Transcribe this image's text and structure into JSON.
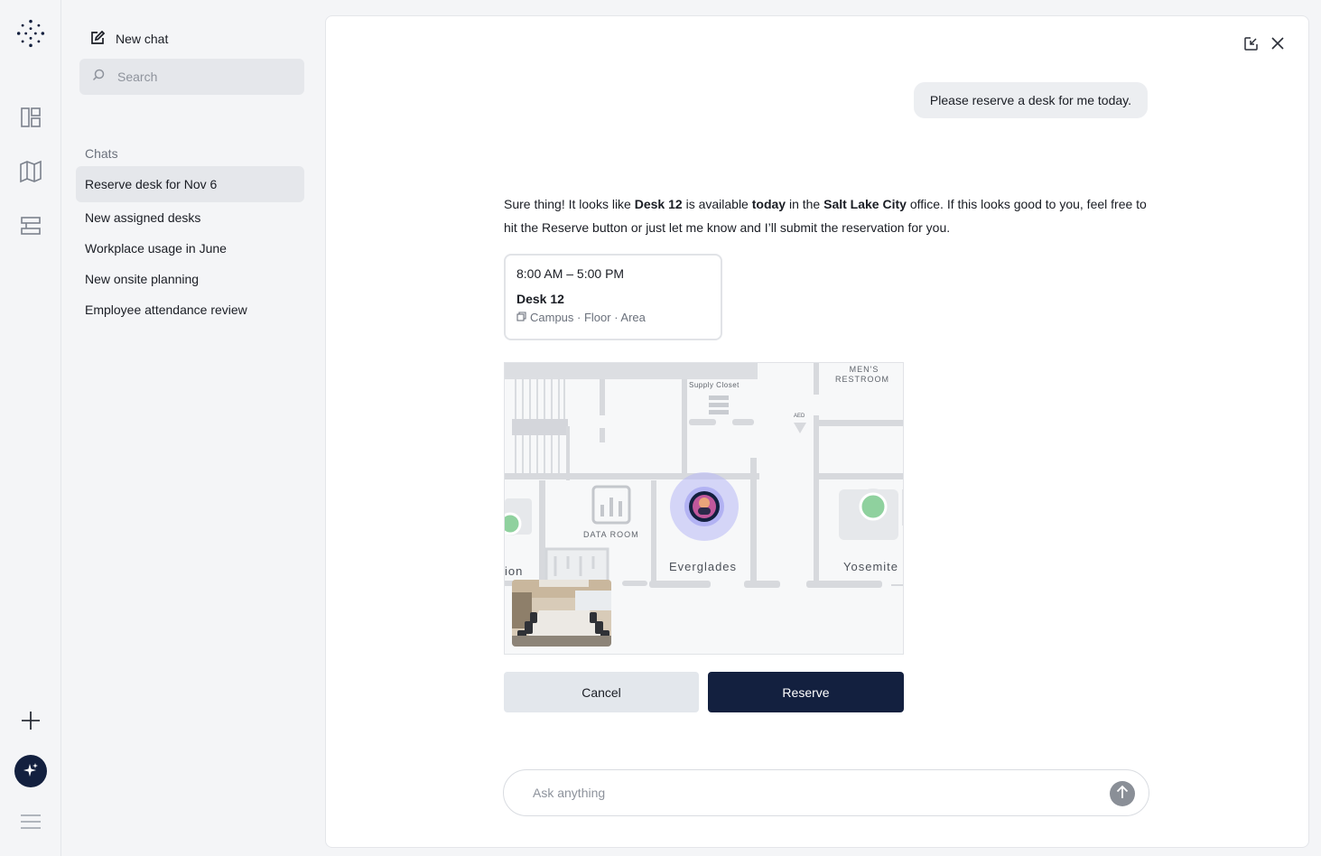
{
  "rail": {
    "icons": [
      "logo-icon",
      "dashboard-icon",
      "map-icon",
      "desk-icon",
      "plus-icon",
      "ai-sparkle-icon",
      "menu-icon"
    ]
  },
  "sidebar": {
    "new_chat_label": "New chat",
    "search_placeholder": "Search",
    "chats_heading": "Chats",
    "chats": [
      {
        "label": "Reserve desk for Nov 6",
        "active": true
      },
      {
        "label": "New assigned desks",
        "active": false
      },
      {
        "label": "Workplace usage in June",
        "active": false
      },
      {
        "label": "New onsite planning",
        "active": false
      },
      {
        "label": "Employee attendance review",
        "active": false
      }
    ]
  },
  "conversation": {
    "user_message": "Please reserve a desk for me today.",
    "assistant": {
      "p1": "Sure thing! It looks like ",
      "desk": "Desk 12",
      "p2": " is available ",
      "when": "today",
      "p3": " in the ",
      "office": "Salt Lake City",
      "p4": " office. If this looks good to you, feel free to hit the Reserve button or just let me know and I’ll submit the reservation for you."
    }
  },
  "reservation": {
    "time": "8:00 AM – 5:00 PM",
    "desk": "Desk 12",
    "location": "Campus · Floor · Area"
  },
  "map": {
    "labels": {
      "mens_restroom_1": "MEN'S",
      "mens_restroom_2": "RESTROOM",
      "supply_closet": "Supply Closet",
      "aed": "AED",
      "data_room": "DATA ROOM",
      "everglades": "Everglades",
      "yosemite": "Yosemite",
      "partial_room": "ion"
    }
  },
  "actions": {
    "cancel": "Cancel",
    "reserve": "Reserve"
  },
  "composer": {
    "placeholder": "Ask anything"
  },
  "colors": {
    "primary": "#13203f",
    "accent_green": "#8fd19e",
    "location_glow": "#b8b8f5"
  }
}
